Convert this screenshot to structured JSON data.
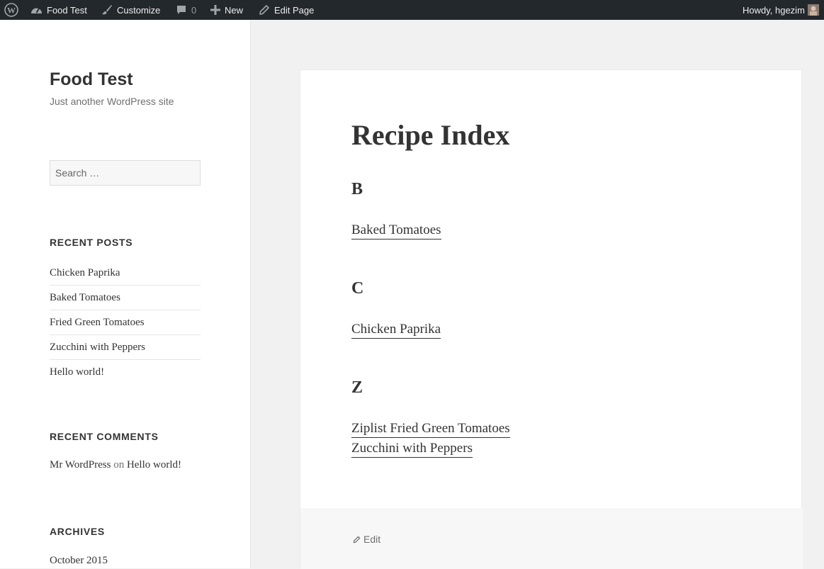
{
  "adminbar": {
    "site_name": "Food Test",
    "customize": "Customize",
    "comments_count": "0",
    "new_label": "New",
    "edit_page": "Edit Page",
    "howdy": "Howdy, hgezim"
  },
  "sidebar": {
    "site_title": "Food Test",
    "site_description": "Just another WordPress site",
    "search_placeholder": "Search …",
    "recent_posts_title": "RECENT POSTS",
    "recent_posts": [
      "Chicken Paprika",
      "Baked Tomatoes",
      "Fried Green Tomatoes",
      "Zucchini with Peppers",
      "Hello world!"
    ],
    "recent_comments_title": "RECENT COMMENTS",
    "comment": {
      "author": "Mr WordPress",
      "on": "on",
      "post": "Hello world!"
    },
    "archives_title": "ARCHIVES",
    "archives": [
      "October 2015"
    ]
  },
  "main": {
    "page_title": "Recipe Index",
    "sections": [
      {
        "letter": "B",
        "recipes": [
          "Baked Tomatoes"
        ]
      },
      {
        "letter": "C",
        "recipes": [
          "Chicken Paprika"
        ]
      },
      {
        "letter": "Z",
        "recipes": [
          "Ziplist Fried Green Tomatoes",
          "Zucchini with Peppers"
        ]
      }
    ],
    "edit_label": "Edit"
  }
}
